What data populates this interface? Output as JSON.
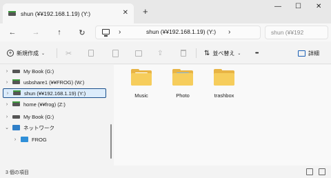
{
  "window": {
    "tab_title": "shun (¥¥192.168.1.19) (Y:)",
    "tab_close": "✕",
    "new_tab": "+",
    "minimize": "—",
    "maximize": "☐",
    "close": "✕"
  },
  "nav": {
    "back": "←",
    "forward": "→",
    "up": "↑",
    "refresh": "↻",
    "chevron": "›"
  },
  "address": {
    "path": "shun (¥¥192.168.1.19) (Y:)",
    "search_placeholder": "shun (¥¥192"
  },
  "toolbar": {
    "new_label": "新規作成",
    "sort_label": "並べ替え",
    "more_label": "•••",
    "details_label": "詳細"
  },
  "sidebar": {
    "items": [
      {
        "label": "My Book (G:)"
      },
      {
        "label": "usbshare1 (¥¥FROG) (W:)"
      },
      {
        "label": "shun (¥¥192.168.1.19) (Y:)"
      },
      {
        "label": "home (¥¥frog) (Z:)"
      },
      {
        "label": "My Book (G:)"
      },
      {
        "label": "ネットワーク"
      },
      {
        "label": "FROG"
      }
    ]
  },
  "files": [
    {
      "name": "Music",
      "icon": "folder-icon"
    },
    {
      "name": "Photo",
      "icon": "folder-images-icon"
    },
    {
      "name": "trashbox",
      "icon": "folder-icon"
    }
  ],
  "status": {
    "count_text": "3 個の項目"
  },
  "colors": {
    "folder": "#f6cd5c",
    "folder_back": "#e8b445",
    "selection_border": "#1a4f8b",
    "selection_bg": "#dcecfb",
    "network_drive": "#3c9a3c"
  }
}
